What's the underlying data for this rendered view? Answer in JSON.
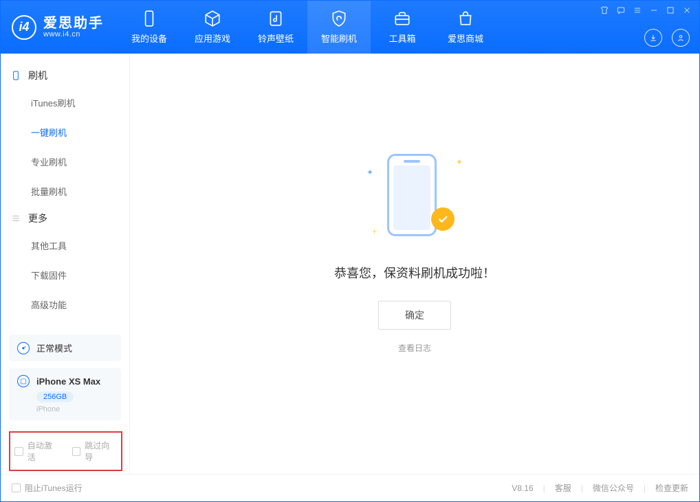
{
  "app": {
    "title": "爱思助手",
    "subtitle": "www.i4.cn"
  },
  "nav": {
    "device": "我的设备",
    "apps": "应用游戏",
    "ringtone": "铃声壁纸",
    "flash": "智能刷机",
    "toolbox": "工具箱",
    "store": "爱思商城"
  },
  "sidebar": {
    "group1": {
      "title": "刷机",
      "items": [
        "iTunes刷机",
        "一键刷机",
        "专业刷机",
        "批量刷机"
      ],
      "active_index": 1
    },
    "group2": {
      "title": "更多",
      "items": [
        "其他工具",
        "下载固件",
        "高级功能"
      ]
    }
  },
  "device_status": {
    "mode": "正常模式"
  },
  "device": {
    "name": "iPhone XS Max",
    "storage": "256GB",
    "type": "iPhone"
  },
  "options": {
    "auto_activate": "自动激活",
    "skip_guide": "跳过向导"
  },
  "main": {
    "success_title": "恭喜您，保资料刷机成功啦！",
    "ok": "确定",
    "view_log": "查看日志"
  },
  "footer": {
    "block_itunes": "阻止iTunes运行",
    "version": "V8.16",
    "support": "客服",
    "wechat": "微信公众号",
    "update": "检查更新"
  }
}
